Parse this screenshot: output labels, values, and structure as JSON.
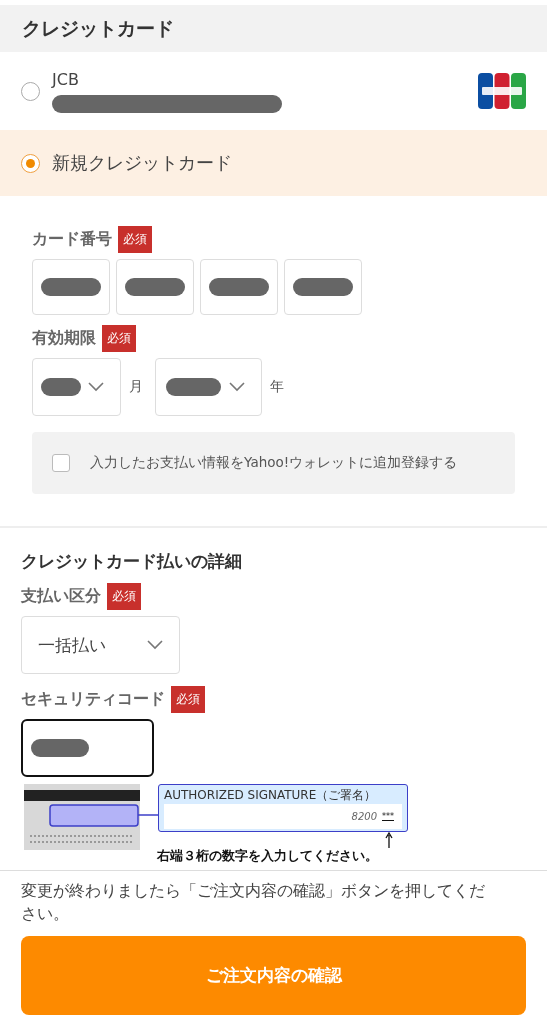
{
  "section_title": "クレジットカード",
  "payment_options": [
    {
      "kind": "saved_card",
      "label": "JCB",
      "selected": false
    },
    {
      "kind": "new_card",
      "label": "新規クレジットカード",
      "selected": true
    }
  ],
  "card_form": {
    "card_number": {
      "label": "カード番号",
      "badge": "必須"
    },
    "expiry": {
      "label": "有効期限",
      "badge": "必須",
      "month_unit": "月",
      "year_unit": "年"
    },
    "wallet_option": {
      "label": "入力したお支払い情報をYahoo!ウォレットに追加登録する",
      "checked": false
    }
  },
  "details": {
    "title": "クレジットカード払いの詳細",
    "payment_type": {
      "label": "支払い区分",
      "badge": "必須",
      "value": "一括払い"
    },
    "security_code": {
      "label": "セキュリティコード",
      "badge": "必須",
      "focused": true
    },
    "illustration": {
      "signature_label": "AUTHORIZED SIGNATURE（ご署名）",
      "card_digits": "8200",
      "code_mark": "***",
      "hint": "右端３桁の数字を入力してください。"
    }
  },
  "footer": {
    "note": "変更が終わりましたら「ご注文内容の確認」ボタンを押してください。",
    "button": "ご注文内容の確認"
  }
}
